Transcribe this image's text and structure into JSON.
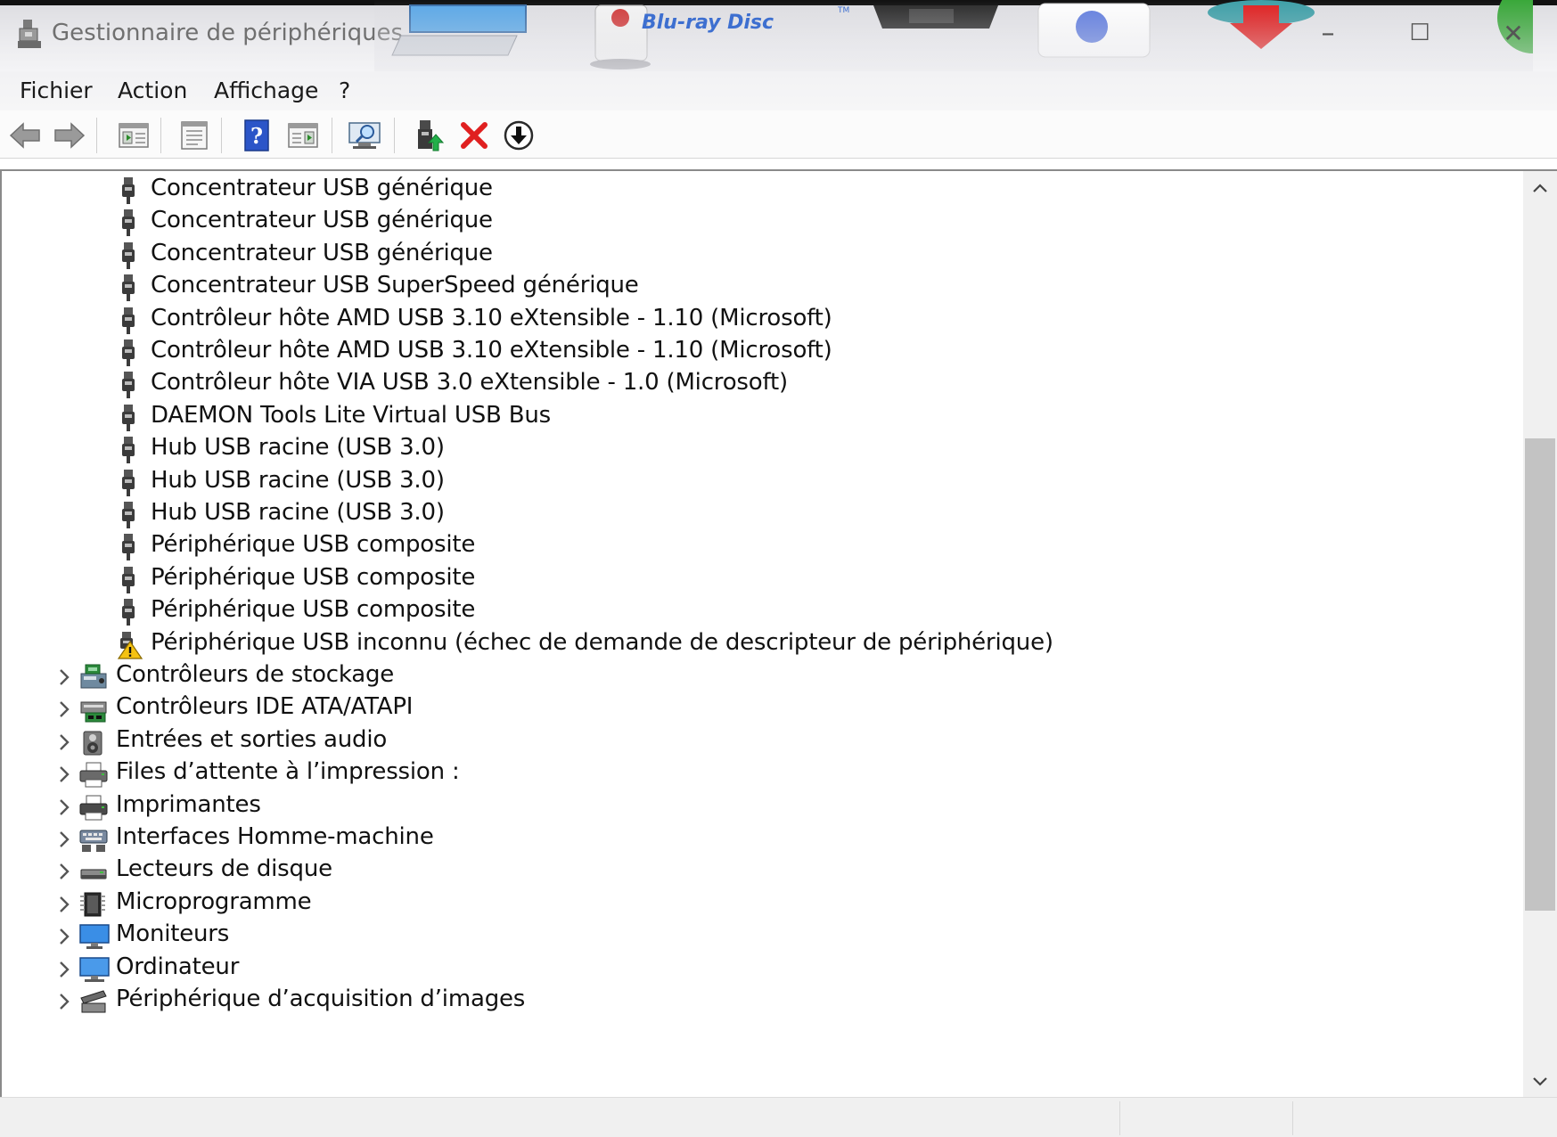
{
  "window": {
    "title": "Gestionnaire de périphériques",
    "decor_text": "Blu-ray Disc",
    "decor_tm": "TM",
    "minimize_glyph": "–",
    "maximize_glyph": "☐",
    "close_glyph": "✕"
  },
  "menu": {
    "items": [
      "Fichier",
      "Action",
      "Affichage",
      "?"
    ]
  },
  "toolbar": {
    "buttons": [
      {
        "name": "back-icon",
        "tooltip": "Précédent"
      },
      {
        "name": "forward-icon",
        "tooltip": "Suivant"
      },
      {
        "name": "show-hide-console-tree-icon"
      },
      {
        "name": "properties-icon"
      },
      {
        "name": "help-icon"
      },
      {
        "name": "show-hide-action-pane-icon"
      },
      {
        "name": "scan-hardware-changes-icon"
      },
      {
        "name": "update-driver-icon"
      },
      {
        "name": "uninstall-device-icon"
      },
      {
        "name": "disable-device-icon"
      }
    ]
  },
  "tree": {
    "usb_children": [
      {
        "label": "Concentrateur USB générique",
        "icon": "usb-plug-icon"
      },
      {
        "label": "Concentrateur USB générique",
        "icon": "usb-plug-icon"
      },
      {
        "label": "Concentrateur USB générique",
        "icon": "usb-plug-icon"
      },
      {
        "label": "Concentrateur USB SuperSpeed générique",
        "icon": "usb-plug-icon"
      },
      {
        "label": "Contrôleur hôte AMD USB 3.10 eXtensible - 1.10 (Microsoft)",
        "icon": "usb-plug-icon"
      },
      {
        "label": "Contrôleur hôte AMD USB 3.10 eXtensible - 1.10 (Microsoft)",
        "icon": "usb-plug-icon"
      },
      {
        "label": "Contrôleur hôte VIA USB 3.0 eXtensible - 1.0 (Microsoft)",
        "icon": "usb-plug-icon"
      },
      {
        "label": "DAEMON Tools Lite Virtual USB Bus",
        "icon": "usb-plug-icon"
      },
      {
        "label": "Hub USB racine (USB 3.0)",
        "icon": "usb-plug-icon"
      },
      {
        "label": "Hub USB racine (USB 3.0)",
        "icon": "usb-plug-icon"
      },
      {
        "label": "Hub USB racine (USB 3.0)",
        "icon": "usb-plug-icon"
      },
      {
        "label": "Périphérique USB composite",
        "icon": "usb-plug-icon"
      },
      {
        "label": "Périphérique USB composite",
        "icon": "usb-plug-icon"
      },
      {
        "label": "Périphérique USB composite",
        "icon": "usb-plug-icon"
      },
      {
        "label": "Périphérique USB inconnu (échec de demande de descripteur de périphérique)",
        "icon": "usb-warning-icon"
      }
    ],
    "categories": [
      {
        "label": "Contrôleurs de stockage",
        "icon": "storage-controller-icon"
      },
      {
        "label": "Contrôleurs IDE ATA/ATAPI",
        "icon": "ide-controller-icon"
      },
      {
        "label": "Entrées et sorties audio",
        "icon": "speaker-icon"
      },
      {
        "label": "Files d’attente à l’impression :",
        "icon": "print-queue-icon"
      },
      {
        "label": "Imprimantes",
        "icon": "printer-icon"
      },
      {
        "label": "Interfaces Homme-machine",
        "icon": "hid-icon"
      },
      {
        "label": "Lecteurs de disque",
        "icon": "disk-drive-icon"
      },
      {
        "label": "Microprogramme",
        "icon": "firmware-chip-icon"
      },
      {
        "label": "Moniteurs",
        "icon": "monitor-icon"
      },
      {
        "label": "Ordinateur",
        "icon": "computer-icon"
      },
      {
        "label": "Périphérique d’acquisition d’images",
        "icon": "imaging-device-icon"
      }
    ]
  },
  "colors": {
    "warning": "#f5c211",
    "delete_red": "#e02020",
    "help_blue": "#2b55c8",
    "monitor_blue": "#3a8ee6"
  }
}
